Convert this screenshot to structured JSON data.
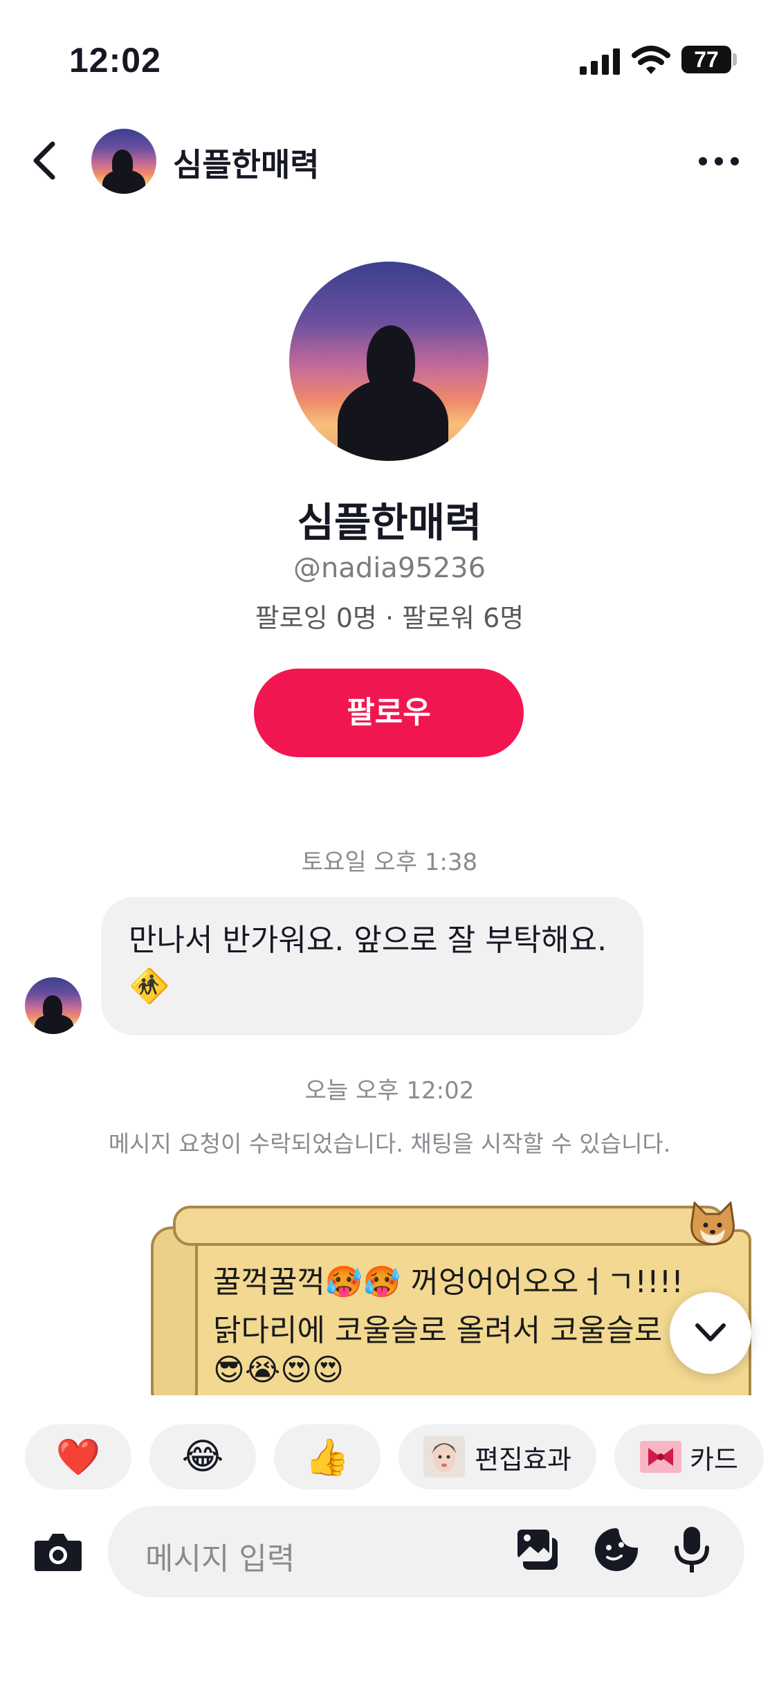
{
  "status_bar": {
    "time": "12:02",
    "battery": "77"
  },
  "header": {
    "title": "심플한매력"
  },
  "profile": {
    "name": "심플한매력",
    "handle": "@nadia95236",
    "stats": "팔로잉 0명 · 팔로워 6명",
    "follow_label": "팔로우"
  },
  "messages": {
    "timestamp_1": "토요일 오후 1:38",
    "greeting_text": "만나서 반가워요. 앞으로 잘 부탁해요.",
    "greeting_emoji": "🚸",
    "timestamp_2": "오늘 오후 12:02",
    "system_notice": "메시지 요청이 수락되었습니다. 채팅을 시작할 수 있습니다.",
    "card_line_1": "꿀꺽꿀꺽🥵🥵 꺼엉어어오오ㅓㄱ!!!!",
    "card_line_2": "닭다리에 코울슬로 올려서 코울슬로",
    "card_line_3": "😎😭😍😍"
  },
  "quick_replies": {
    "heart": "❤️",
    "laugh": "😂",
    "thumbs": "👍",
    "effects_label": "편집효과",
    "card_label": "카드"
  },
  "composer": {
    "placeholder": "메시지 입력"
  },
  "colors": {
    "accent": "#f1164f",
    "bubble": "#f1f1f2",
    "muted": "#8a8a90"
  }
}
